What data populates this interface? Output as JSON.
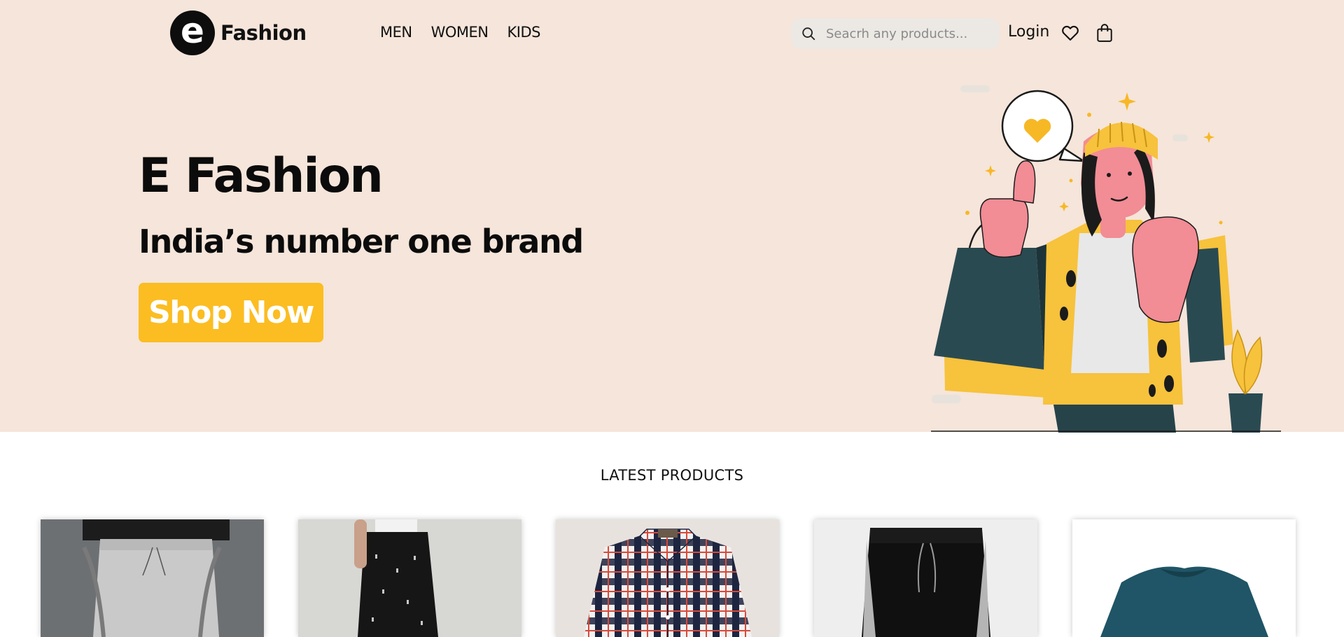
{
  "brand": {
    "logo_letter": "e",
    "name": "Fashion"
  },
  "nav": {
    "items": [
      {
        "label": "MEN"
      },
      {
        "label": "WOMEN"
      },
      {
        "label": "KIDS"
      }
    ]
  },
  "search": {
    "placeholder": "Seacrh any products...",
    "value": ""
  },
  "header": {
    "login_label": "Login",
    "wishlist_icon": "heart-icon",
    "cart_icon": "shopping-bag-icon",
    "search_icon": "search-icon"
  },
  "hero": {
    "title": "E Fashion",
    "subtitle": "India’s number one brand",
    "cta_label": "Shop Now"
  },
  "latest": {
    "title": "LATEST PRODUCTS",
    "products": [
      {
        "image": "grey-joggers-photo"
      },
      {
        "image": "black-printed-trousers-photo"
      },
      {
        "image": "plaid-shirt-photo"
      },
      {
        "image": "black-track-pants-photo"
      },
      {
        "image": "teal-sweatshirt-photo"
      }
    ]
  },
  "colors": {
    "hero_bg": "#f5e5da",
    "accent": "#fbbd21",
    "text": "#111111",
    "search_bg": "#ece8e4"
  }
}
